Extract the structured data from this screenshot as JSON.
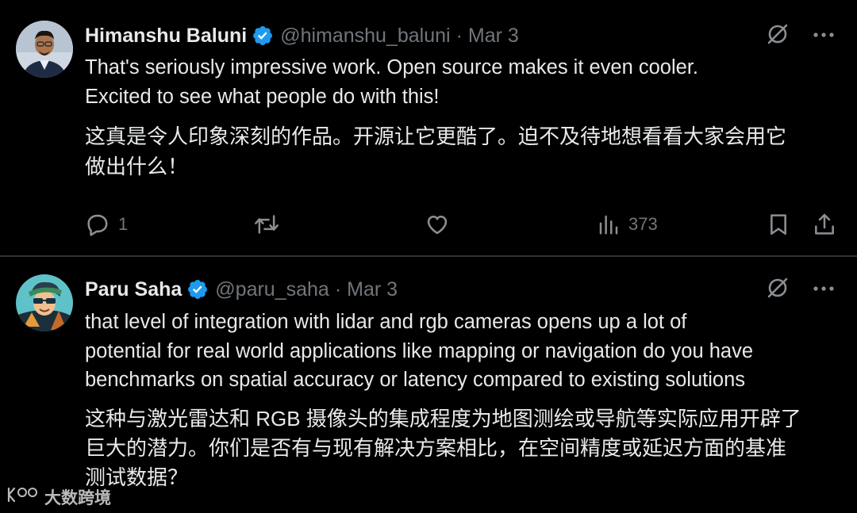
{
  "tweets": [
    {
      "author_name": "Himanshu Baluni",
      "handle": "@himanshu_baluni",
      "separator": "·",
      "date": "Mar 3",
      "text_en": [
        "That's seriously impressive work. Open source makes it even cooler.",
        "Excited to see what people do with this!"
      ],
      "text_zh": [
        "这真是令人印象深刻的作品。开源让它更酷了。迫不及待地想看看大家会用它",
        "做出什么！"
      ],
      "reply_count": "1",
      "retweet_count": "",
      "like_count": "",
      "view_count": "373"
    },
    {
      "author_name": "Paru Saha",
      "handle": "@paru_saha",
      "separator": "·",
      "date": "Mar 3",
      "text_en": [
        "that level of integration with lidar and rgb cameras opens up a lot of",
        "potential for real world applications like mapping or navigation do you have",
        "benchmarks on spatial accuracy or latency compared to existing solutions"
      ],
      "text_zh": [
        "这种与激光雷达和 RGB 摄像头的集成程度为地图测绘或导航等实际应用开辟了",
        "巨大的潜力。你们是否有与现有解决方案相比，在空间精度或延迟方面的基准",
        "测试数据？"
      ]
    }
  ],
  "watermark": {
    "text": "大数跨境"
  },
  "icons": {
    "verified": "verified-badge-icon",
    "grok": "grok-icon",
    "more": "more-icon",
    "reply": "reply-icon",
    "retweet": "retweet-icon",
    "like": "like-icon",
    "views": "views-icon",
    "bookmark": "bookmark-icon",
    "share": "share-icon"
  },
  "colors": {
    "background": "#000000",
    "text": "#e7e9ea",
    "secondary": "#71767b",
    "verified": "#1d9bf0",
    "divider": "#2f3336"
  }
}
